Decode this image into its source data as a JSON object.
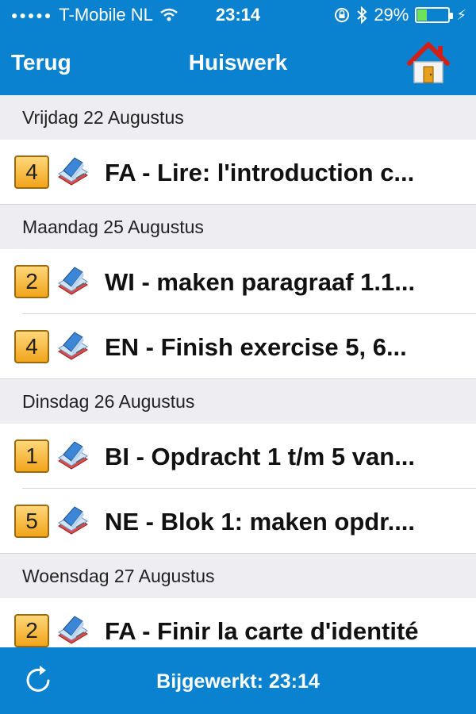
{
  "status": {
    "carrier": "T-Mobile NL",
    "time": "23:14",
    "battery": "29%",
    "battery_level": 0.29
  },
  "nav": {
    "back_label": "Terug",
    "title": "Huiswerk",
    "home_icon": "home-icon"
  },
  "sections": [
    {
      "header": "Vrijdag 22 Augustus",
      "items": [
        {
          "hour": "4",
          "text": "FA - Lire: l'introduction c..."
        }
      ]
    },
    {
      "header": "Maandag 25 Augustus",
      "items": [
        {
          "hour": "2",
          "text": "WI - maken paragraaf 1.1..."
        },
        {
          "hour": "4",
          "text": "EN - Finish exercise 5, 6..."
        }
      ]
    },
    {
      "header": "Dinsdag 26 Augustus",
      "items": [
        {
          "hour": "1",
          "text": "BI - Opdracht 1 t/m 5 van..."
        },
        {
          "hour": "5",
          "text": "NE - Blok 1: maken opdr...."
        }
      ]
    },
    {
      "header": "Woensdag 27 Augustus",
      "items": [
        {
          "hour": "2",
          "text": "FA - Finir la carte d'identité"
        }
      ]
    }
  ],
  "footer": {
    "updated_label": "Bijgewerkt: 23:14",
    "refresh_icon": "refresh-icon"
  },
  "colors": {
    "bar_blue": "#0a82cf",
    "section_bg": "#ededf2",
    "badge_orange": "#f1a51b"
  }
}
